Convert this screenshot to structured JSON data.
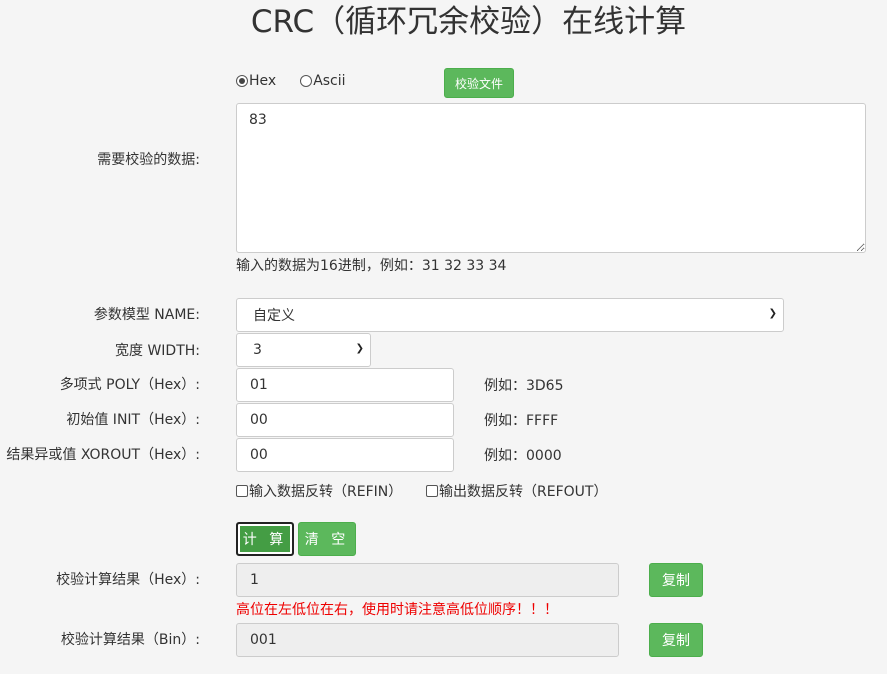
{
  "page": {
    "title": "CRC（循环冗余校验）在线计算"
  },
  "input_mode": {
    "hex_label": "Hex",
    "ascii_label": "Ascii",
    "selected": "Hex",
    "file_button_label": "校验文件"
  },
  "data_input": {
    "label": "需要校验的数据:",
    "value": "83",
    "hint": "输入的数据为16进制，例如：31 32 33 34"
  },
  "model": {
    "label": "参数模型 NAME:",
    "selected": "自定义"
  },
  "width": {
    "label": "宽度 WIDTH:",
    "selected": "3"
  },
  "poly": {
    "label": "多项式 POLY（Hex）:",
    "value": "01",
    "example": "例如：3D65"
  },
  "init": {
    "label": "初始值 INIT（Hex）:",
    "value": "00",
    "example": "例如：FFFF"
  },
  "xorout": {
    "label": "结果异或值 XOROUT（Hex）:",
    "value": "00",
    "example": "例如：0000"
  },
  "refin": {
    "label": "输入数据反转（REFIN）",
    "checked": false
  },
  "refout": {
    "label": "输出数据反转（REFOUT）",
    "checked": false
  },
  "actions": {
    "calculate_label": "计 算",
    "clear_label": "清 空"
  },
  "result_hex": {
    "label": "校验计算结果（Hex）:",
    "value": "1",
    "copy_label": "复制",
    "warning": "高位在左低位在右，使用时请注意高低位顺序！！！"
  },
  "result_bin": {
    "label": "校验计算结果（Bin）:",
    "value": "001",
    "copy_label": "复制"
  },
  "colors": {
    "accent_green": "#5cb85c",
    "warning_red": "#ee0000"
  }
}
